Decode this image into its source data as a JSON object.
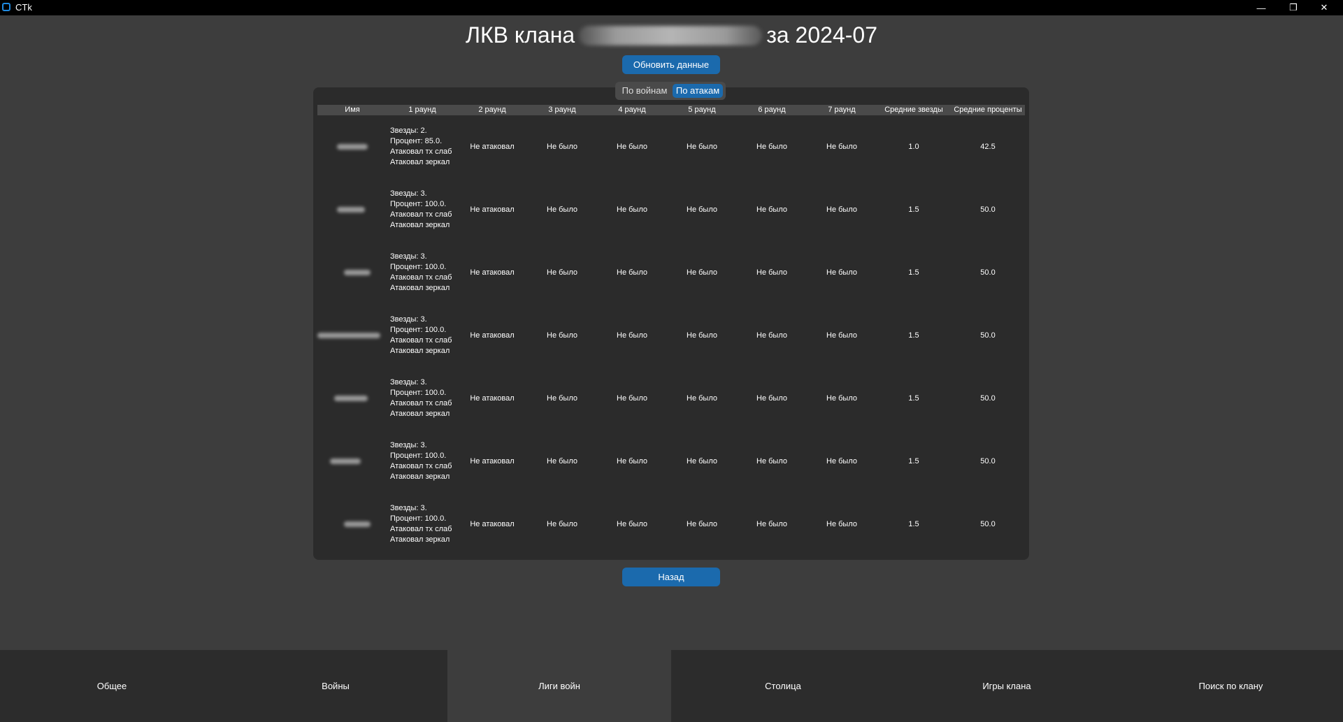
{
  "window": {
    "app_title": "CTk",
    "minimize_glyph": "—",
    "maximize_glyph": "❐",
    "close_glyph": "✕"
  },
  "header": {
    "title_prefix": "ЛКВ клана",
    "title_suffix": "за 2024-07",
    "refresh_label": "Обновить данные"
  },
  "view_toggle": {
    "by_wars": "По войнам",
    "by_attacks": "По атакам",
    "selected": "По атакам"
  },
  "table": {
    "columns": [
      "Имя",
      "1 раунд",
      "2 раунд",
      "3 раунд",
      "4 раунд",
      "5 раунд",
      "6 раунд",
      "7 раунд",
      "Средние звезды",
      "Средние проценты"
    ],
    "rows": [
      {
        "r1": [
          "Звезды: 2.",
          "Процент: 85.0.",
          "Атаковал тх слаб",
          "Атаковал зеркал"
        ],
        "r2": "Не атаковал",
        "r3": "Не было",
        "r4": "Не было",
        "r5": "Не было",
        "r6": "Не было",
        "r7": "Не было",
        "avg_stars": "1.0",
        "avg_percent": "42.5"
      },
      {
        "r1": [
          "Звезды: 3.",
          "Процент: 100.0.",
          "Атаковал тх слаб",
          "Атаковал зеркал"
        ],
        "r2": "Не атаковал",
        "r3": "Не было",
        "r4": "Не было",
        "r5": "Не было",
        "r6": "Не было",
        "r7": "Не было",
        "avg_stars": "1.5",
        "avg_percent": "50.0"
      },
      {
        "r1": [
          "Звезды: 3.",
          "Процент: 100.0.",
          "Атаковал тх слаб",
          "Атаковал зеркал"
        ],
        "r2": "Не атаковал",
        "r3": "Не было",
        "r4": "Не было",
        "r5": "Не было",
        "r6": "Не было",
        "r7": "Не было",
        "avg_stars": "1.5",
        "avg_percent": "50.0"
      },
      {
        "r1": [
          "Звезды: 3.",
          "Процент: 100.0.",
          "Атаковал тх слаб",
          "Атаковал зеркал"
        ],
        "r2": "Не атаковал",
        "r3": "Не было",
        "r4": "Не было",
        "r5": "Не было",
        "r6": "Не было",
        "r7": "Не было",
        "avg_stars": "1.5",
        "avg_percent": "50.0"
      },
      {
        "r1": [
          "Звезды: 3.",
          "Процент: 100.0.",
          "Атаковал тх слаб",
          "Атаковал зеркал"
        ],
        "r2": "Не атаковал",
        "r3": "Не было",
        "r4": "Не было",
        "r5": "Не было",
        "r6": "Не было",
        "r7": "Не было",
        "avg_stars": "1.5",
        "avg_percent": "50.0"
      },
      {
        "r1": [
          "Звезды: 3.",
          "Процент: 100.0.",
          "Атаковал тх слаб",
          "Атаковал зеркал"
        ],
        "r2": "Не атаковал",
        "r3": "Не было",
        "r4": "Не было",
        "r5": "Не было",
        "r6": "Не было",
        "r7": "Не было",
        "avg_stars": "1.5",
        "avg_percent": "50.0"
      },
      {
        "r1": [
          "Звезды: 3.",
          "Процент: 100.0.",
          "Атаковал тх слаб",
          "Атаковал зеркал"
        ],
        "r2": "Не атаковал",
        "r3": "Не было",
        "r4": "Не было",
        "r5": "Не было",
        "r6": "Не было",
        "r7": "Не было",
        "avg_stars": "1.5",
        "avg_percent": "50.0"
      }
    ]
  },
  "footer": {
    "back_label": "Назад"
  },
  "bottom_nav": {
    "tabs": [
      "Общее",
      "Войны",
      "Лиги войн",
      "Столица",
      "Игры клана",
      "Поиск по клану"
    ],
    "active": "Лиги войн"
  },
  "colors": {
    "accent": "#1b6aad",
    "background": "#3d3d3d",
    "panel": "#2b2b2b",
    "header_row": "#4a4a4a",
    "bottom_nav": "#2c2c2c"
  }
}
